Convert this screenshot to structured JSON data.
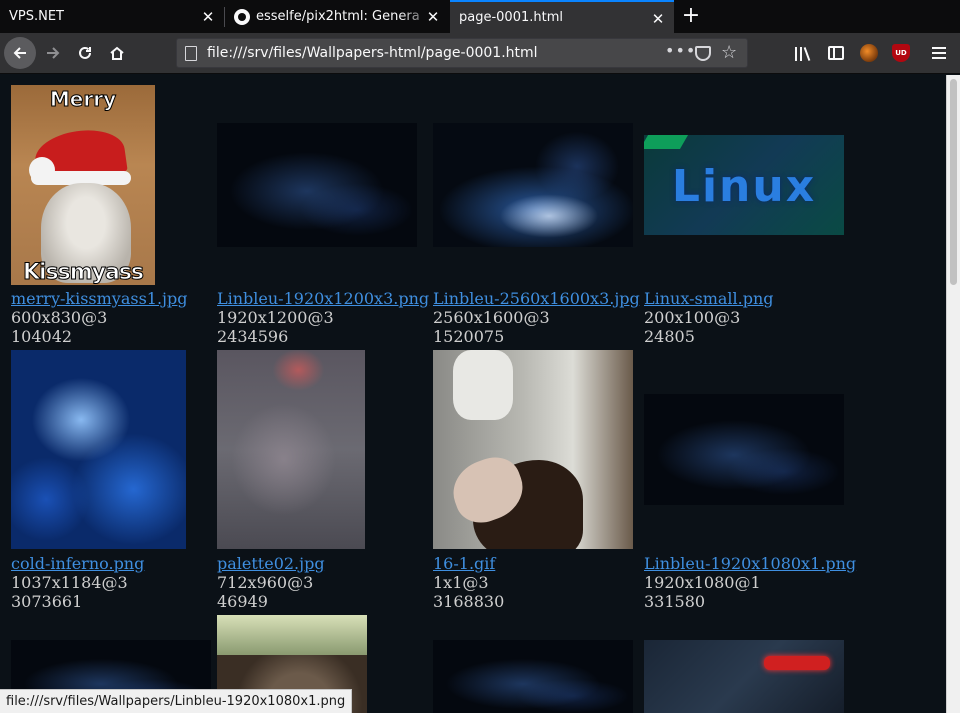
{
  "browser": {
    "tabs": [
      {
        "title": "VPS.NET",
        "active": false
      },
      {
        "title": "esselfe/pix2html: Genera",
        "active": false
      },
      {
        "title": "page-0001.html",
        "active": true
      }
    ],
    "new_tab": "+",
    "url": "file:///srv/files/Wallpapers-html/page-0001.html",
    "page_actions": "•••",
    "star": "☆",
    "extension_badge": "UD",
    "status_url": "file:///srv/files/Wallpapers/Linbleu-1920x1080x1.png"
  },
  "gallery": [
    {
      "name": "merry-kissmyass1.jpg",
      "dims": "600x830@3",
      "size": "104042",
      "thumb_top_text": "Merry",
      "thumb_bottom_text": "Kissmyass"
    },
    {
      "name": "Linbleu-1920x1200x3.png",
      "dims": "1920x1200@3",
      "size": "2434596"
    },
    {
      "name": "Linbleu-2560x1600x3.jpg",
      "dims": "2560x1600@3",
      "size": "1520075"
    },
    {
      "name": "Linux-small.png",
      "dims": "200x100@3",
      "size": "24805",
      "thumb_text": "Linux"
    },
    {
      "name": "cold-inferno.png",
      "dims": "1037x1184@3",
      "size": "3073661"
    },
    {
      "name": "palette02.jpg",
      "dims": "712x960@3",
      "size": "46949"
    },
    {
      "name": "16-1.gif",
      "dims": "1x1@3",
      "size": "3168830"
    },
    {
      "name": "Linbleu-1920x1080x1.png",
      "dims": "1920x1080@1",
      "size": "331580"
    }
  ],
  "colors": {
    "page_bg": "#0b1117",
    "link": "#3f8fe0",
    "tab_accent": "#0a84ff",
    "toolbar": "#323234"
  }
}
